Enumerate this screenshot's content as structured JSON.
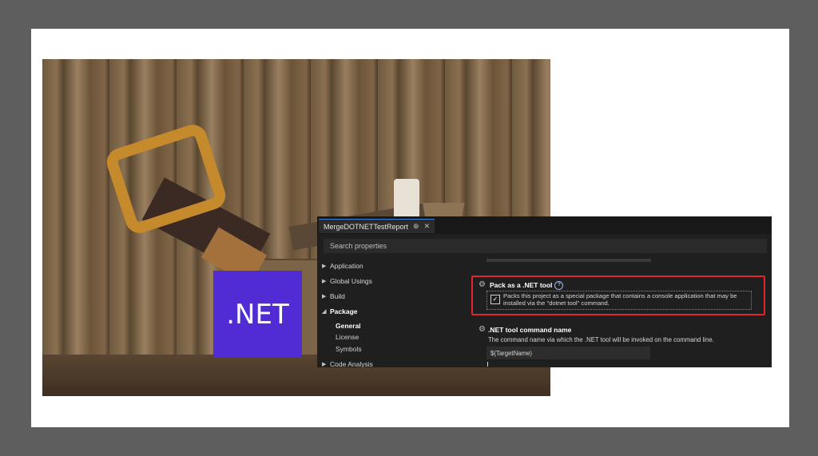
{
  "logo": {
    "text": ".NET",
    "color": "#512bd4"
  },
  "vs": {
    "tab": {
      "title": "MergeDOTNETTestReport",
      "pin_icon": "pin-icon",
      "close_icon": "close-icon"
    },
    "search": {
      "placeholder": "Search properties"
    },
    "nav": {
      "items": [
        {
          "label": "Application"
        },
        {
          "label": "Global Usings"
        },
        {
          "label": "Build"
        },
        {
          "label": "Package",
          "expanded": true
        },
        {
          "label": "Code Analysis"
        }
      ],
      "package_children": [
        {
          "label": "General",
          "active": true
        },
        {
          "label": "License"
        },
        {
          "label": "Symbols"
        }
      ]
    },
    "pack_tool": {
      "title": "Pack as a .NET tool",
      "help": "?",
      "checked": true,
      "check_mark": "✓",
      "description_line1": "Packs this project as a special package that contains a console application that may be",
      "description_line2": "installed via the \"dotnet tool\" command.",
      "highlight_color": "#e2242b"
    },
    "command_name": {
      "title": ".NET tool command name",
      "description": "The command name via which the .NET tool will be invoked on the command line.",
      "value": "$(TargetName)"
    }
  }
}
